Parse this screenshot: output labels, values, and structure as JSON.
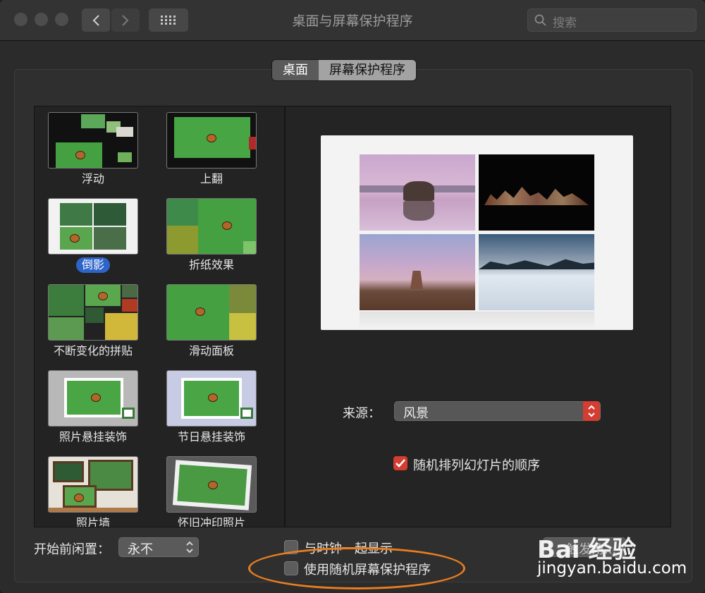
{
  "window": {
    "title": "桌面与屏幕保护程序"
  },
  "search": {
    "placeholder": "搜索"
  },
  "tabs": [
    {
      "label": "桌面"
    },
    {
      "label": "屏幕保护程序"
    }
  ],
  "screensavers": [
    {
      "label": "浮动"
    },
    {
      "label": "上翻"
    },
    {
      "label": "倒影",
      "selected": true
    },
    {
      "label": "折纸效果"
    },
    {
      "label": "不断变化的拼贴"
    },
    {
      "label": "滑动面板"
    },
    {
      "label": "照片悬挂装饰"
    },
    {
      "label": "节日悬挂装饰"
    },
    {
      "label": "照片墙"
    },
    {
      "label": "怀旧冲印照片"
    }
  ],
  "source": {
    "label": "来源：",
    "value": "风景"
  },
  "shuffle": {
    "label": "随机排列幻灯片的顺序",
    "checked": true
  },
  "idle": {
    "label": "开始前闲置：",
    "value": "永不"
  },
  "show_clock": {
    "label": "与时钟一起显示",
    "checked": false
  },
  "random_saver": {
    "label": "使用随机屏幕保护程序",
    "checked": false
  },
  "hot_corners": {
    "label": "触发角..."
  },
  "watermark": {
    "brand": "Bai 经验",
    "url": "jingyan.baidu.com"
  },
  "colors": {
    "accent": "#d43d31",
    "selection": "#2d64c8",
    "annotation": "#e97e1e"
  }
}
